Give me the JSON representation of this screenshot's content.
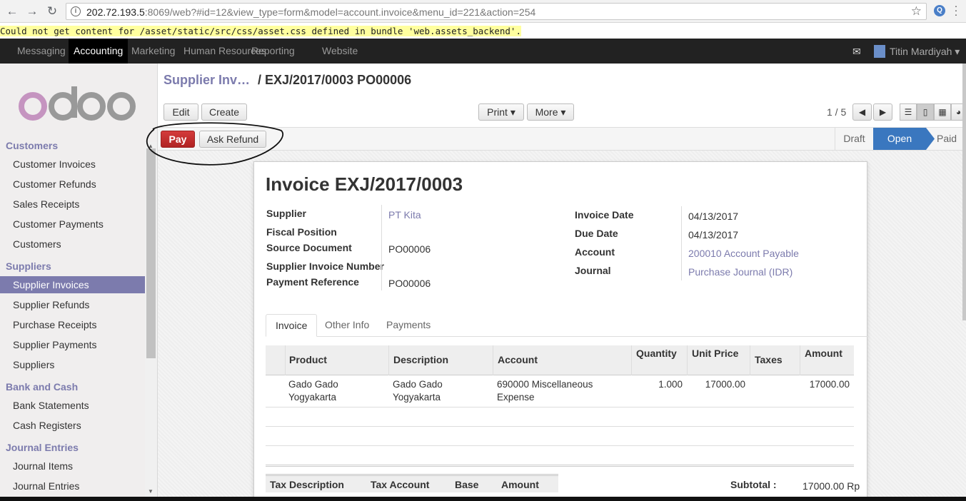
{
  "browser": {
    "url_host": "202.72.193.5",
    "url_rest": ":8069/web?#id=12&view_type=form&model=account.invoice&menu_id=221&action=254",
    "back_icon": "arrow-left-icon",
    "forward_icon": "arrow-right-icon",
    "reload_icon": "reload-icon"
  },
  "error_message": "Could not get content for /asset/static/src/css/asset.css defined in bundle 'web.assets_backend'.",
  "topnav": {
    "items": [
      "Messaging",
      "Accounting",
      "Marketing",
      "Human Resources",
      "Reporting",
      "Website"
    ],
    "active": "Accounting",
    "user": "Titin Mardiyah"
  },
  "sidebar": {
    "logo": "odoo",
    "sections": [
      {
        "title": "Customers",
        "items": [
          "Customer Invoices",
          "Customer Refunds",
          "Sales Receipts",
          "Customer Payments",
          "Customers"
        ]
      },
      {
        "title": "Suppliers",
        "items": [
          "Supplier Invoices",
          "Supplier Refunds",
          "Purchase Receipts",
          "Supplier Payments",
          "Suppliers"
        ]
      },
      {
        "title": "Bank and Cash",
        "items": [
          "Bank Statements",
          "Cash Registers"
        ]
      },
      {
        "title": "Journal Entries",
        "items": [
          "Journal Items",
          "Journal Entries"
        ]
      }
    ],
    "active_item": "Supplier Invoices"
  },
  "breadcrumb": {
    "parent": "Supplier Inv…",
    "current": "/ EXJ/2017/0003 PO00006"
  },
  "toolbar": {
    "edit": "Edit",
    "create": "Create",
    "print": "Print ▾",
    "more": "More ▾",
    "pager": "1 / 5"
  },
  "statusbar": {
    "pay": "Pay",
    "refund": "Ask Refund",
    "stages": [
      "Draft",
      "Open",
      "Paid"
    ],
    "active_stage": "Open"
  },
  "invoice": {
    "title": "Invoice EXJ/2017/0003",
    "left_fields": [
      {
        "label": "Supplier",
        "value": "PT Kita"
      },
      {
        "label": "Fiscal Position",
        "value": ""
      },
      {
        "label": "Source Document",
        "value": "PO00006"
      },
      {
        "label": "Supplier Invoice Number",
        "value": ""
      },
      {
        "label": "Payment Reference",
        "value": "PO00006"
      }
    ],
    "right_fields": [
      {
        "label": "Invoice Date",
        "value": "04/13/2017"
      },
      {
        "label": "Due Date",
        "value": "04/13/2017"
      },
      {
        "label": "Account",
        "value": "200010 Account Payable"
      },
      {
        "label": "Journal",
        "value": "Purchase Journal (IDR)"
      }
    ],
    "tabs": [
      "Invoice",
      "Other Info",
      "Payments"
    ],
    "columns": [
      "Product",
      "Description",
      "Account",
      "Quantity",
      "Unit Price",
      "Taxes",
      "Amount"
    ],
    "lines": [
      {
        "product_1": "Gado Gado",
        "product_2": "Yogyakarta",
        "description_1": "Gado Gado",
        "description_2": "Yogyakarta",
        "account_1": "690000 Miscellaneous",
        "account_2": "Expense",
        "quantity": "1.000",
        "unit_price": "17000.00",
        "taxes": "",
        "amount": "17000.00"
      }
    ],
    "tax_columns": [
      "Tax Description",
      "Tax Account",
      "Base",
      "Amount"
    ],
    "subtotal_label": "Subtotal :",
    "subtotal_value": "17000.00 Rp"
  }
}
